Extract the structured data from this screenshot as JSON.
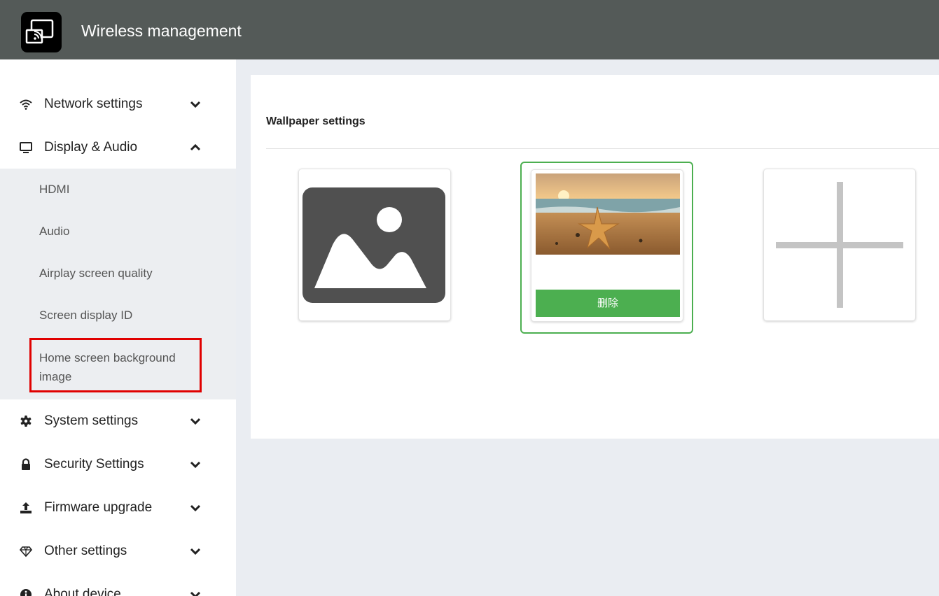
{
  "header": {
    "title": "Wireless management",
    "logo_icon": "screen-cast-icon",
    "background": "#545a58"
  },
  "sidebar": {
    "items": [
      {
        "label": "Network settings",
        "icon": "wifi-icon",
        "expanded": false
      },
      {
        "label": "Display & Audio",
        "icon": "monitor-icon",
        "expanded": true
      },
      {
        "label": "System settings",
        "icon": "gear-icon",
        "expanded": false
      },
      {
        "label": "Security Settings",
        "icon": "lock-icon",
        "expanded": false
      },
      {
        "label": "Firmware upgrade",
        "icon": "upload-icon",
        "expanded": false
      },
      {
        "label": "Other settings",
        "icon": "diamond-icon",
        "expanded": false
      },
      {
        "label": "About device",
        "icon": "info-icon",
        "expanded": false
      }
    ],
    "display_audio_submenu": [
      {
        "label": "HDMI"
      },
      {
        "label": "Audio"
      },
      {
        "label": "Airplay screen quality"
      },
      {
        "label": "Screen display ID"
      },
      {
        "label": "Home screen background image",
        "active": true
      }
    ]
  },
  "main": {
    "panel_title": "Wallpaper settings",
    "wallpapers": [
      {
        "kind": "default",
        "icon": "image-placeholder-icon"
      },
      {
        "kind": "custom",
        "image": "beach-starfish-photo",
        "selected": true,
        "delete_label": "删除"
      },
      {
        "kind": "add",
        "icon": "plus-icon"
      }
    ]
  },
  "colors": {
    "accent_green": "#4caf50",
    "highlight_red": "#e00000",
    "main_bg": "#eaedf2",
    "submenu_bg": "#eceef1"
  }
}
